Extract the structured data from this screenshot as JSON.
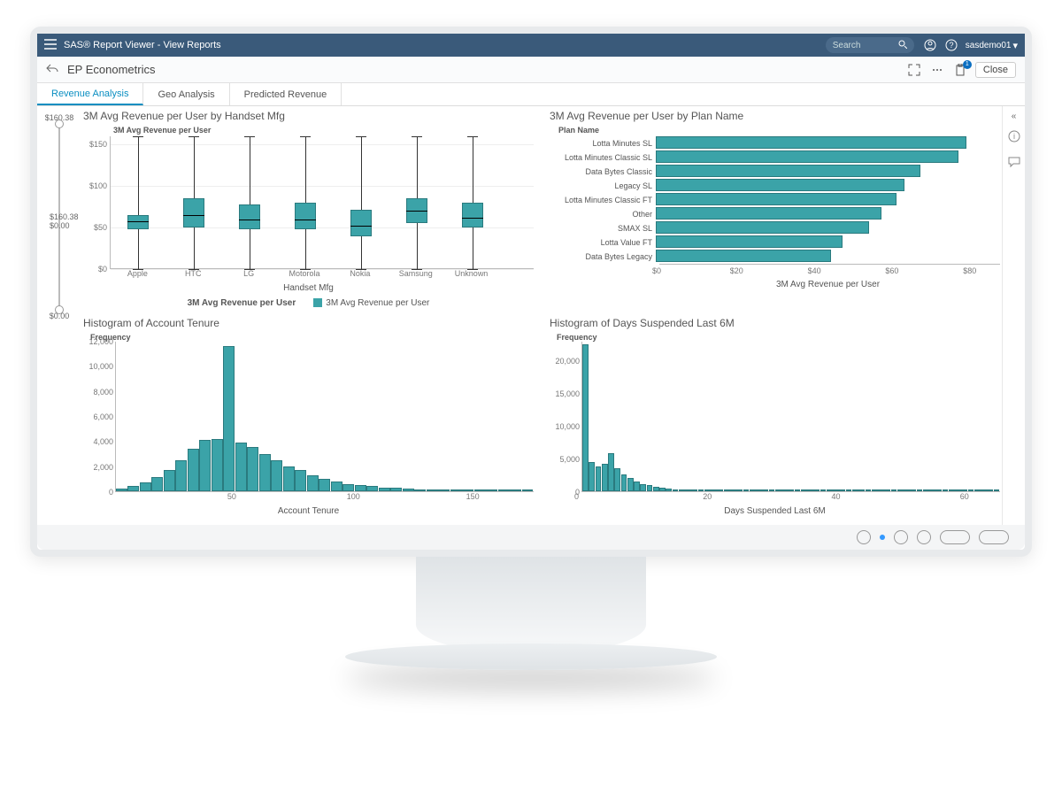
{
  "colors": {
    "accent": "#3ba3a8",
    "topbar": "#3a5a7a",
    "link": "#0a8ec1"
  },
  "topbar": {
    "title": "SAS® Report Viewer - View Reports",
    "search_placeholder": "Search",
    "user": "sasdemo01"
  },
  "subheader": {
    "report_title": "EP Econometrics",
    "close_label": "Close",
    "badge": "1"
  },
  "tabs": [
    {
      "label": "Revenue Analysis",
      "active": true
    },
    {
      "label": "Geo Analysis",
      "active": false
    },
    {
      "label": "Predicted Revenue",
      "active": false
    }
  ],
  "slider": {
    "top_label": "$160.38",
    "mid_upper": "$160.38",
    "mid_lower": "$0.00",
    "bottom_label": "$0.00"
  },
  "chart_data": [
    {
      "id": "boxplot",
      "type": "boxplot",
      "title": "3M Avg Revenue per User by Handset Mfg",
      "ylabel": "3M Avg Revenue per User",
      "xlabel": "Handset Mfg",
      "yticks": [
        0,
        50,
        100,
        150
      ],
      "ytick_labels": [
        "$0",
        "$50",
        "$100",
        "$150"
      ],
      "ylim": [
        0,
        160
      ],
      "categories": [
        "Apple",
        "HTC",
        "LG",
        "Motorola",
        "Nokia",
        "Samsung",
        "Unknown"
      ],
      "series": [
        {
          "name": "Apple",
          "min": 0,
          "q1": 48,
          "median": 58,
          "q3": 65,
          "max": 160
        },
        {
          "name": "HTC",
          "min": 0,
          "q1": 50,
          "median": 65,
          "q3": 85,
          "max": 160
        },
        {
          "name": "LG",
          "min": 0,
          "q1": 48,
          "median": 60,
          "q3": 78,
          "max": 160
        },
        {
          "name": "Motorola",
          "min": 0,
          "q1": 48,
          "median": 60,
          "q3": 80,
          "max": 160
        },
        {
          "name": "Nokia",
          "min": 0,
          "q1": 40,
          "median": 52,
          "q3": 72,
          "max": 160
        },
        {
          "name": "Samsung",
          "min": 0,
          "q1": 55,
          "median": 70,
          "q3": 85,
          "max": 160
        },
        {
          "name": "Unknown",
          "min": 0,
          "q1": 50,
          "median": 62,
          "q3": 80,
          "max": 160
        }
      ],
      "legend": [
        "3M Avg Revenue per User",
        "3M Avg Revenue per User"
      ]
    },
    {
      "id": "hbar",
      "type": "bar",
      "orientation": "horizontal",
      "title": "3M Avg Revenue per User by Plan Name",
      "ylabel": "Plan Name",
      "xlabel": "3M Avg Revenue per User",
      "xticks": [
        0,
        20,
        40,
        60,
        80
      ],
      "xtick_labels": [
        "$0",
        "$20",
        "$40",
        "$60",
        "$80"
      ],
      "xlim": [
        0,
        82
      ],
      "categories": [
        "Lotta Minutes SL",
        "Lotta Minutes Classic SL",
        "Data Bytes Classic",
        "Legacy SL",
        "Lotta Minutes Classic FT",
        "Other",
        "SMAX SL",
        "Lotta Value FT",
        "Data Bytes Legacy"
      ],
      "values": [
        80,
        78,
        68,
        64,
        62,
        58,
        55,
        48,
        45
      ]
    },
    {
      "id": "hist_tenure",
      "type": "histogram",
      "title": "Histogram of Account Tenure",
      "ylabel": "Frequency",
      "xlabel": "Account Tenure",
      "xlim": [
        0,
        175
      ],
      "xticks": [
        50,
        100,
        150
      ],
      "ylim": [
        0,
        12000
      ],
      "yticks": [
        0,
        2000,
        4000,
        6000,
        8000,
        10000,
        12000
      ],
      "ytick_labels": [
        "0",
        "2,000",
        "4,000",
        "6,000",
        "8,000",
        "10,000",
        "12,000"
      ],
      "bins_start": 0,
      "bin_width": 5,
      "values": [
        200,
        400,
        700,
        1100,
        1700,
        2500,
        3400,
        4100,
        4200,
        11600,
        3900,
        3500,
        3000,
        2500,
        2000,
        1700,
        1300,
        1000,
        800,
        600,
        500,
        400,
        300,
        250,
        200,
        150,
        120,
        100,
        80,
        60,
        50,
        40,
        30,
        20,
        10
      ]
    },
    {
      "id": "hist_suspended",
      "type": "histogram",
      "title": "Histogram of Days Suspended Last 6M",
      "ylabel": "Frequency",
      "xlabel": "Days Suspended Last 6M",
      "xlim": [
        0,
        65
      ],
      "xticks": [
        0,
        20,
        40,
        60
      ],
      "ylim": [
        0,
        23000
      ],
      "yticks": [
        0,
        5000,
        10000,
        15000,
        20000
      ],
      "ytick_labels": [
        "0",
        "5,000",
        "10,000",
        "15,000",
        "20,000"
      ],
      "bins_start": 0,
      "bin_width": 1,
      "values": [
        22500,
        4500,
        3800,
        4200,
        5800,
        3500,
        2600,
        2000,
        1500,
        1100,
        900,
        700,
        550,
        400,
        300,
        250,
        200,
        150,
        120,
        100,
        80,
        60,
        50,
        40,
        30,
        25,
        20,
        15,
        12,
        10,
        8,
        6,
        5,
        4,
        3,
        3,
        2,
        2,
        2,
        1,
        1,
        1,
        1,
        1,
        1,
        1,
        1,
        1,
        1,
        1,
        1,
        1,
        1,
        1,
        1,
        1,
        1,
        1,
        1,
        1,
        1,
        1,
        1,
        1,
        1
      ]
    }
  ]
}
